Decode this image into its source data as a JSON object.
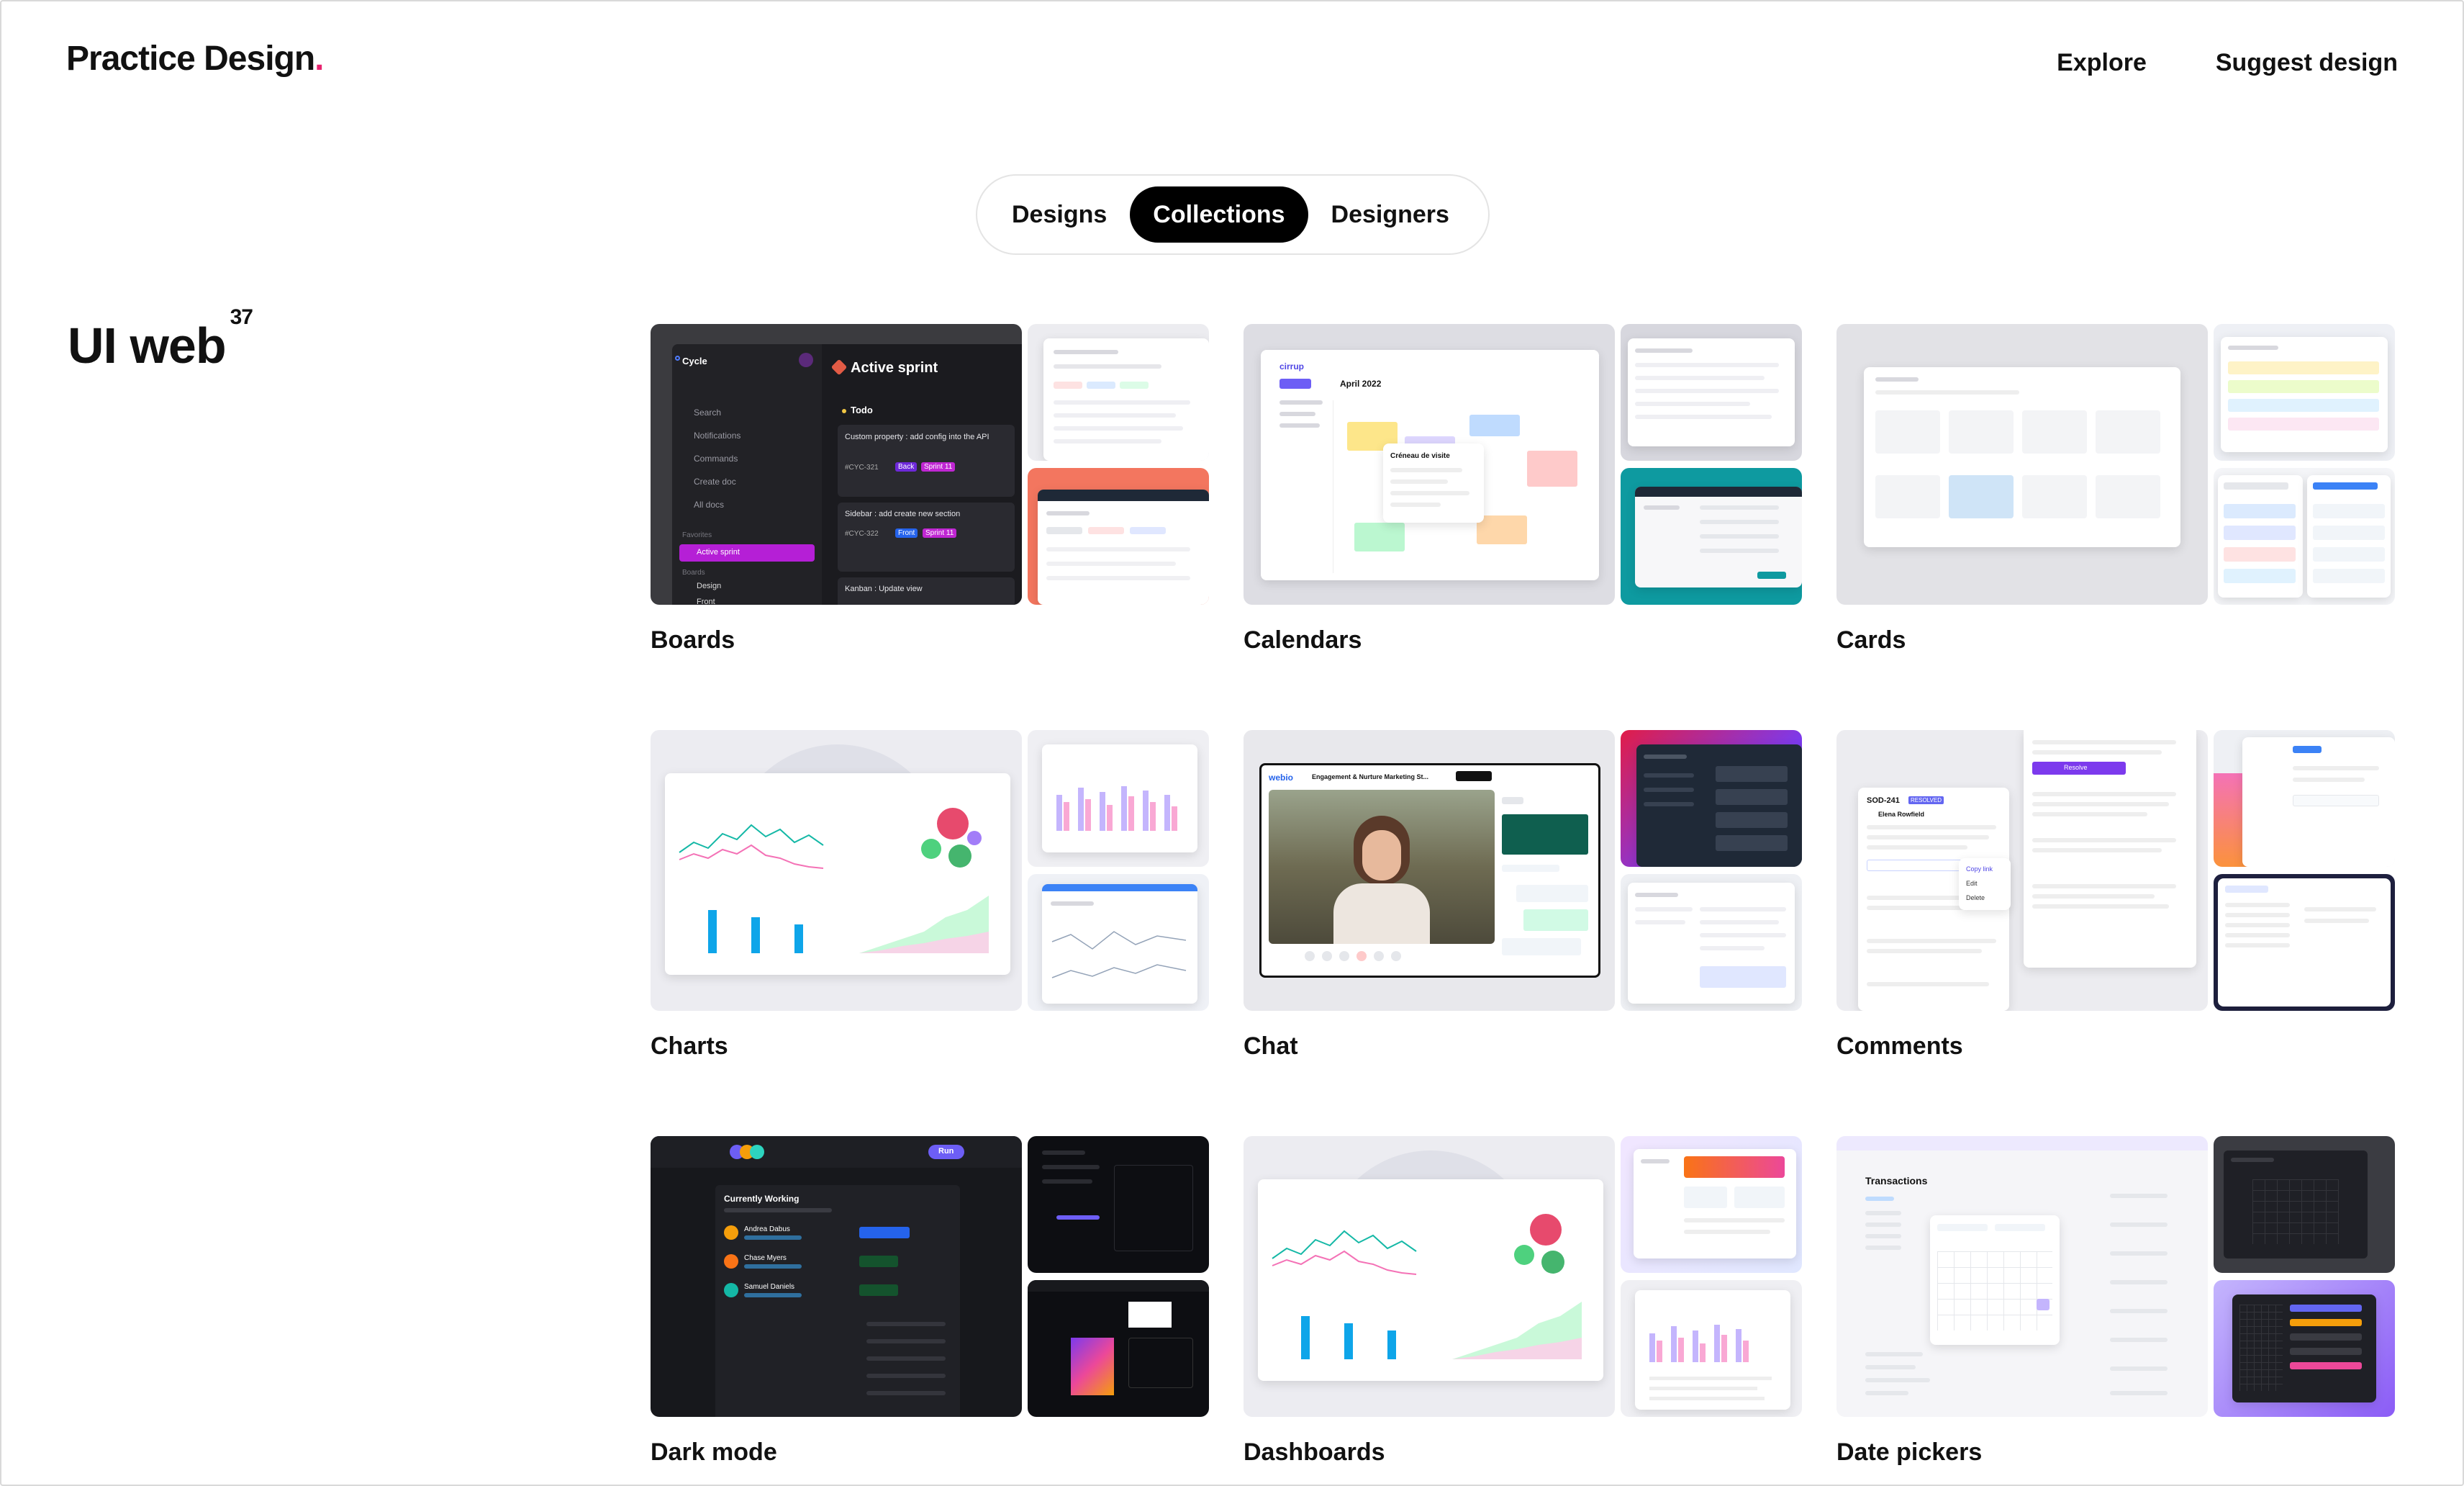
{
  "header": {
    "logo_text": "Practice Design",
    "logo_dot": ".",
    "nav": {
      "explore": "Explore",
      "suggest": "Suggest design"
    }
  },
  "tabs": {
    "designs": "Designs",
    "collections": "Collections",
    "designers": "Designers",
    "active": "Collections"
  },
  "section": {
    "title": "UI web",
    "count": "37"
  },
  "cards": [
    {
      "label": "Boards"
    },
    {
      "label": "Calendars"
    },
    {
      "label": "Cards"
    },
    {
      "label": "Charts"
    },
    {
      "label": "Chat"
    },
    {
      "label": "Comments"
    },
    {
      "label": "Dark mode"
    },
    {
      "label": "Dashboards"
    },
    {
      "label": "Date pickers"
    }
  ],
  "previews": {
    "boards": {
      "workspace": "Cycle",
      "heading": "Active sprint",
      "group": "Todo",
      "menu": [
        "Search",
        "Notifications",
        "Commands",
        "Create doc",
        "All docs"
      ],
      "favorites_label": "Favorites",
      "favorite_item": "Active sprint",
      "boards_label": "Boards",
      "board_items": [
        "Design",
        "Front"
      ],
      "tasks": [
        {
          "title": "Custom property : add config into the API",
          "id": "#CYC-321",
          "tags": [
            "Back",
            "Sprint 11"
          ]
        },
        {
          "title": "Sidebar : add create new section",
          "id": "#CYC-322",
          "tags": [
            "Front",
            "Sprint 11"
          ]
        },
        {
          "title": "Kanban : Update view"
        }
      ]
    },
    "calendars": {
      "brand": "cirrup",
      "month": "April 2022",
      "popup_title": "Créneau de visite"
    },
    "chat": {
      "brand": "webio",
      "title": "Engagement & Nurture Marketing St..."
    },
    "comments": {
      "ticket": "SOD-241",
      "status": "RESOLVED",
      "author": "Elena Rowfield",
      "menu": [
        "Copy link",
        "Edit",
        "Delete"
      ],
      "action": "Resolve"
    },
    "darkmode": {
      "heading": "Currently Working",
      "users": [
        "Andrea Dabus",
        "Chase Myers",
        "Samuel Daniels"
      ],
      "run": "Run"
    },
    "datepickers": {
      "heading": "Transactions"
    }
  },
  "colors": {
    "accent_pink": "#e8246f",
    "tab_active_bg": "#000000",
    "dark_panel": "#1e1e22",
    "purple": "#7c3aed",
    "teal": "#0e9aa0",
    "coral": "#f3765f"
  }
}
